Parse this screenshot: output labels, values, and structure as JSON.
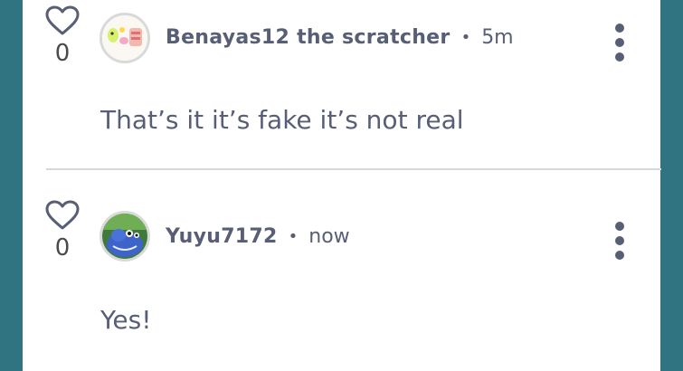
{
  "comments": [
    {
      "like_count": "0",
      "username": "Benayas12 the scratcher",
      "separator": "•",
      "time": "5m",
      "text": "That’s it it’s fake it’s not real",
      "avatar_icon": "pastel-sticker-avatar-icon"
    },
    {
      "like_count": "0",
      "username": "Yuyu7172",
      "separator": "•",
      "time": "now",
      "text": "Yes!",
      "avatar_icon": "blue-creature-avatar-icon"
    }
  ],
  "colors": {
    "background": "#2f7480",
    "panel": "#ffffff",
    "text": "#575e75",
    "divider": "#d7d7d7"
  }
}
